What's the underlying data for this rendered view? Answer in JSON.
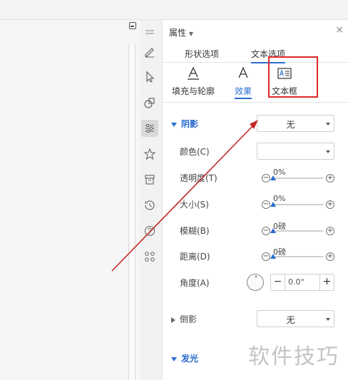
{
  "panel": {
    "title": "属性",
    "close": "×"
  },
  "tabs": [
    {
      "label": "形状选项"
    },
    {
      "label": "文本选项"
    }
  ],
  "subtabs": [
    {
      "label": "填充与轮廓",
      "icon": "text-fill-icon"
    },
    {
      "label": "效果",
      "icon": "text-effect-icon"
    },
    {
      "label": "文本框",
      "icon": "textbox-icon"
    }
  ],
  "shadow": {
    "section": "阴影",
    "preset": "无",
    "color_label": "颜色(C)",
    "color_value": "",
    "transparency_label": "透明度(T)",
    "transparency_value": "0%",
    "size_label": "大小(S)",
    "size_value": "0%",
    "blur_label": "模糊(B)",
    "blur_value": "0磅",
    "distance_label": "距离(D)",
    "distance_value": "0磅",
    "angle_label": "角度(A)",
    "angle_value": "0.0°"
  },
  "reflection": {
    "section": "倒影",
    "preset": "无"
  },
  "glow": {
    "section": "发光"
  },
  "watermark": "软件技巧",
  "colors": {
    "accent": "#2b6ccf",
    "annotation_red": "#e0262a"
  }
}
